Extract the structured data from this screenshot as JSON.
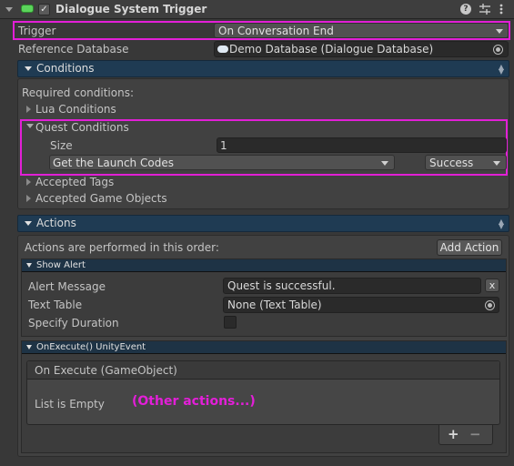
{
  "header": {
    "title": "Dialogue System Trigger",
    "help_icon": "help-icon",
    "preset_icon": "preset-icon",
    "menu_icon": "kebab-menu-icon",
    "enabled_check": "✓"
  },
  "trigger": {
    "label": "Trigger",
    "value": "On Conversation End"
  },
  "reference_database": {
    "label": "Reference Database",
    "value": "Demo Database (Dialogue Database)"
  },
  "conditions": {
    "title": "Conditions",
    "required_label": "Required conditions:",
    "lua_conditions": "Lua Conditions",
    "quest_conditions": {
      "title": "Quest Conditions",
      "size_label": "Size",
      "size_value": "1",
      "quest_name": "Get the Launch Codes",
      "quest_state": "Success"
    },
    "accepted_tags": "Accepted Tags",
    "accepted_game_objects": "Accepted Game Objects"
  },
  "actions": {
    "title": "Actions",
    "order_label": "Actions are performed in this order:",
    "add_action_label": "Add Action",
    "show_alert": {
      "title": "Show Alert",
      "alert_message_label": "Alert Message",
      "alert_message_value": "Quest is successful.",
      "clear_label": "x",
      "text_table_label": "Text Table",
      "text_table_value": "None (Text Table)",
      "specify_duration_label": "Specify Duration"
    },
    "on_execute": {
      "title": "OnExecute() UnityEvent",
      "list_header": "On Execute (GameObject)",
      "empty_label": "List is Empty",
      "plus_label": "+",
      "minus_label": "−"
    }
  },
  "annotation": {
    "note": "(Other actions...)"
  },
  "colors": {
    "highlight": "#e21fd6",
    "section_header": "#1f3b53",
    "annotation": "#e31fd8"
  }
}
